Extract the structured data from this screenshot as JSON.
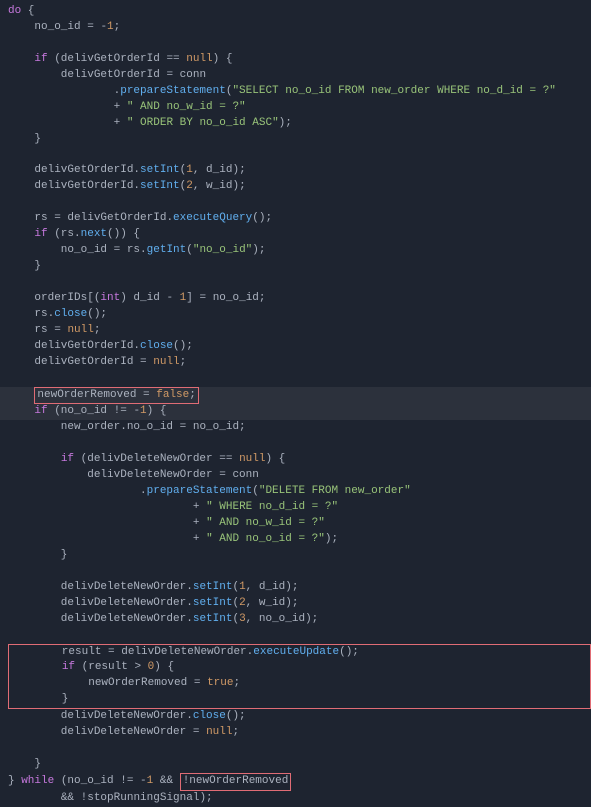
{
  "code": {
    "l1": "do {",
    "l2": "    no_o_id = -1;",
    "l3": "",
    "l4": "    if (delivGetOrderId == null) {",
    "l5": "        delivGetOrderId = conn",
    "l6a": "                .prepareStatement(",
    "l6b": "\"SELECT no_o_id FROM new_order WHERE no_d_id = ?\"",
    "l7a": "                + ",
    "l7b": "\" AND no_w_id = ?\"",
    "l8a": "                + ",
    "l8b": "\" ORDER BY no_o_id ASC\"",
    "l8c": ");",
    "l9": "    }",
    "l10": "",
    "l11a": "    delivGetOrderId.setInt(1, d_id);",
    "l12a": "    delivGetOrderId.setInt(2, w_id);",
    "l13": "",
    "l14": "    rs = delivGetOrderId.executeQuery();",
    "l15": "    if (rs.next()) {",
    "l16": "        no_o_id = rs.getInt(\"no_o_id\");",
    "l17": "    }",
    "l18": "",
    "l19": "    orderIDs[(int) d_id - 1] = no_o_id;",
    "l20": "    rs.close();",
    "l21": "    rs = null;",
    "l22": "    delivGetOrderId.close();",
    "l23": "    delivGetOrderId = null;",
    "l24": "",
    "l25a": "    newOrderRemoved = ",
    "l25b": "false",
    "l25c": ";",
    "l26": "    if (no_o_id != -1) {",
    "l27": "        new_order.no_o_id = no_o_id;",
    "l28": "",
    "l29": "        if (delivDeleteNewOrder == null) {",
    "l30": "            delivDeleteNewOrder = conn",
    "l31a": "                    .prepareStatement(",
    "l31b": "\"DELETE FROM new_order\"",
    "l32a": "                            + ",
    "l32b": "\" WHERE no_d_id = ?\"",
    "l33a": "                            + ",
    "l33b": "\" AND no_w_id = ?\"",
    "l34a": "                            + ",
    "l34b": "\" AND no_o_id = ?\"",
    "l34c": ");",
    "l35": "        }",
    "l36": "",
    "l37": "        delivDeleteNewOrder.setInt(1, d_id);",
    "l38": "        delivDeleteNewOrder.setInt(2, w_id);",
    "l39": "        delivDeleteNewOrder.setInt(3, no_o_id);",
    "l40": "",
    "l41": "        result = delivDeleteNewOrder.executeUpdate();",
    "l42": "        if (result > 0) {",
    "l43": "            newOrderRemoved = true;",
    "l44": "        }",
    "l45": "        delivDeleteNewOrder.close();",
    "l46": "        delivDeleteNewOrder = null;",
    "l47": "",
    "l48": "    }",
    "l49a": "} while (no_o_id != -1 && ",
    "l49b": "!newOrderRemoved",
    "l50": "        && !stopRunningSignal);"
  }
}
